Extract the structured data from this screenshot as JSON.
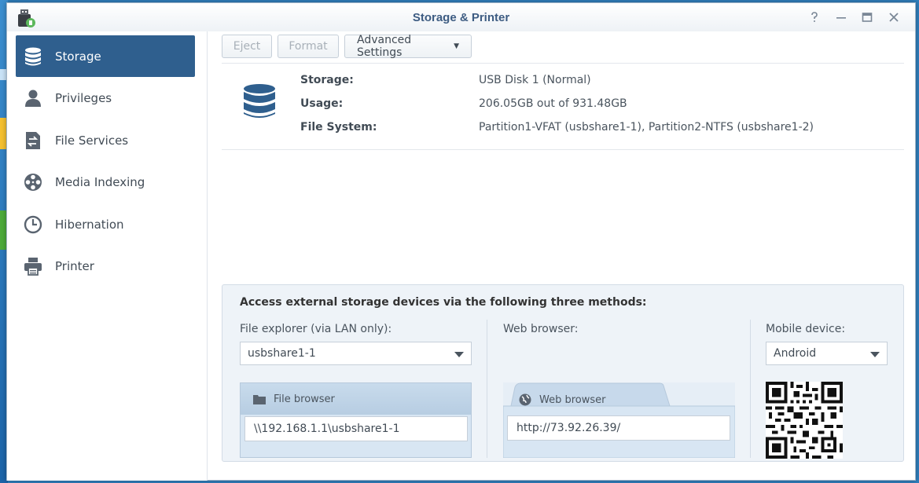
{
  "window": {
    "title": "Storage & Printer",
    "controls": [
      "help-icon",
      "minimize-icon",
      "maximize-icon",
      "close-icon"
    ]
  },
  "sidebar": {
    "items": [
      {
        "label": "Storage",
        "icon": "database-icon",
        "active": true
      },
      {
        "label": "Privileges",
        "icon": "user-icon",
        "active": false
      },
      {
        "label": "File Services",
        "icon": "file-transfer-icon",
        "active": false
      },
      {
        "label": "Media Indexing",
        "icon": "film-reel-icon",
        "active": false
      },
      {
        "label": "Hibernation",
        "icon": "clock-icon",
        "active": false
      },
      {
        "label": "Printer",
        "icon": "printer-icon",
        "active": false
      }
    ]
  },
  "toolbar": {
    "eject_label": "Eject",
    "format_label": "Format",
    "advanced_label": "Advanced Settings"
  },
  "storage_info": {
    "storage_label": "Storage:",
    "storage_value": "USB Disk 1 (Normal)",
    "usage_label": "Usage:",
    "usage_value": "206.05GB out of 931.48GB",
    "fs_label": "File System:",
    "fs_value": "Partition1-VFAT (usbshare1-1), Partition2-NTFS (usbshare1-2)"
  },
  "access": {
    "title": "Access external storage devices via the following three methods:",
    "file_explorer": {
      "label": "File explorer (via LAN only):",
      "selected": "usbshare1-1",
      "panel_title": "File browser",
      "path": "\\\\192.168.1.1\\usbshare1-1"
    },
    "web_browser": {
      "label": "Web browser:",
      "panel_title": "Web browser",
      "url": "http://73.92.26.39/"
    },
    "mobile": {
      "label": "Mobile device:",
      "selected": "Android"
    }
  },
  "colors": {
    "accent": "#2f5f8e",
    "title": "#3d5c82"
  }
}
